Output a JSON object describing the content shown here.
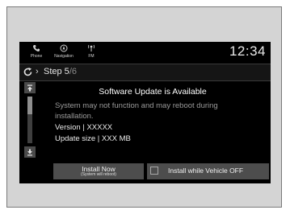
{
  "header": {
    "nav": [
      {
        "label": "Phone",
        "icon": "phone-icon"
      },
      {
        "label": "Navigation",
        "icon": "navigation-icon"
      },
      {
        "label": "FM",
        "icon": "fm-radio-icon"
      }
    ],
    "clock": "12:34"
  },
  "step": {
    "current": "Step 5",
    "total": "/6"
  },
  "dialog": {
    "title": "Software Update is Available",
    "message": "System may not function and may reboot during installation.",
    "version_label": "Version",
    "version_value": "XXXXX",
    "size_label": "Update size",
    "size_value": "XXX MB"
  },
  "actions": {
    "install_now": "Install Now",
    "install_now_note": "(System will reboot)",
    "install_off": "Install while Vehicle OFF"
  }
}
